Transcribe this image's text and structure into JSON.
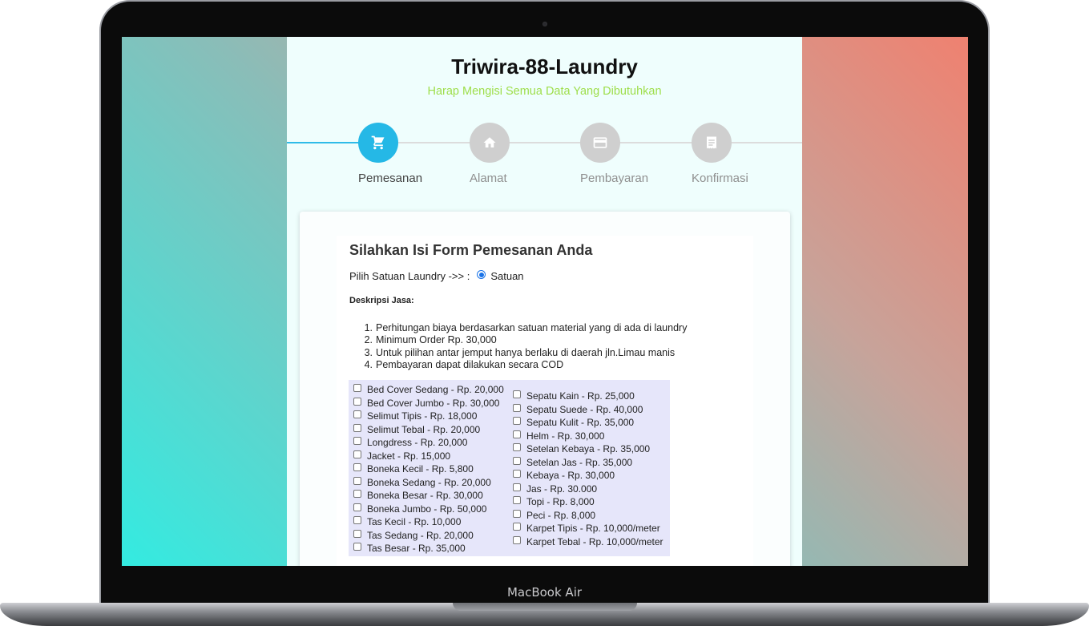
{
  "device": {
    "brand_label": "MacBook Air"
  },
  "site": {
    "title": "Triwira-88-Laundry",
    "subtitle": "Harap Mengisi Semua Data Yang Dibutuhkan"
  },
  "steps": [
    {
      "label": "Pemesanan",
      "icon": "cart-icon",
      "active": true
    },
    {
      "label": "Alamat",
      "icon": "home-icon",
      "active": false
    },
    {
      "label": "Pembayaran",
      "icon": "credit-card-icon",
      "active": false
    },
    {
      "label": "Konfirmasi",
      "icon": "receipt-icon",
      "active": false
    }
  ],
  "colors": {
    "accent": "#25b8e6",
    "subtitle": "#9ede4a",
    "step_inactive": "#cfcfcf",
    "items_bg": "#e6e6fa"
  },
  "form": {
    "title": "Silahkan Isi Form Pemesanan Anda",
    "unit_label": "Pilih Satuan Laundry ->> :",
    "unit_option": "Satuan",
    "unit_selected": true,
    "desc_label": "Deskripsi Jasa:",
    "rules": [
      "Perhitungan biaya berdasarkan satuan material yang di ada di laundry",
      "Minimum Order Rp. 30,000",
      "Untuk pilihan antar jemput hanya berlaku di daerah jln.Limau manis",
      "Pembayaran dapat dilakukan secara COD"
    ],
    "items_left": [
      "Bed Cover Sedang - Rp. 20,000",
      "Bed Cover Jumbo - Rp. 30,000",
      "Selimut Tipis - Rp. 18,000",
      "Selimut Tebal - Rp. 20,000",
      "Longdress - Rp. 20,000",
      "Jacket - Rp. 15,000",
      "Boneka Kecil - Rp. 5,800",
      "Boneka Sedang - Rp. 20,000",
      "Boneka Besar - Rp. 30,000",
      "Boneka Jumbo - Rp. 50,000",
      "Tas Kecil - Rp. 10,000",
      "Tas Sedang - Rp. 20,000",
      "Tas Besar - Rp. 35,000"
    ],
    "items_right": [
      "Sepatu Kain - Rp. 25,000",
      "Sepatu Suede - Rp. 40,000",
      "Sepatu Kulit - Rp. 35,000",
      "Helm - Rp. 30,000",
      "Setelan Kebaya - Rp. 35,000",
      "Setelan Jas - Rp. 35,000",
      "Kebaya - Rp. 30,000",
      "Jas - Rp. 30.000",
      "Topi - Rp. 8,000",
      "Peci - Rp. 8,000",
      "Karpet Tipis - Rp. 10,000/meter",
      "Karpet Tebal - Rp. 10,000/meter"
    ]
  }
}
